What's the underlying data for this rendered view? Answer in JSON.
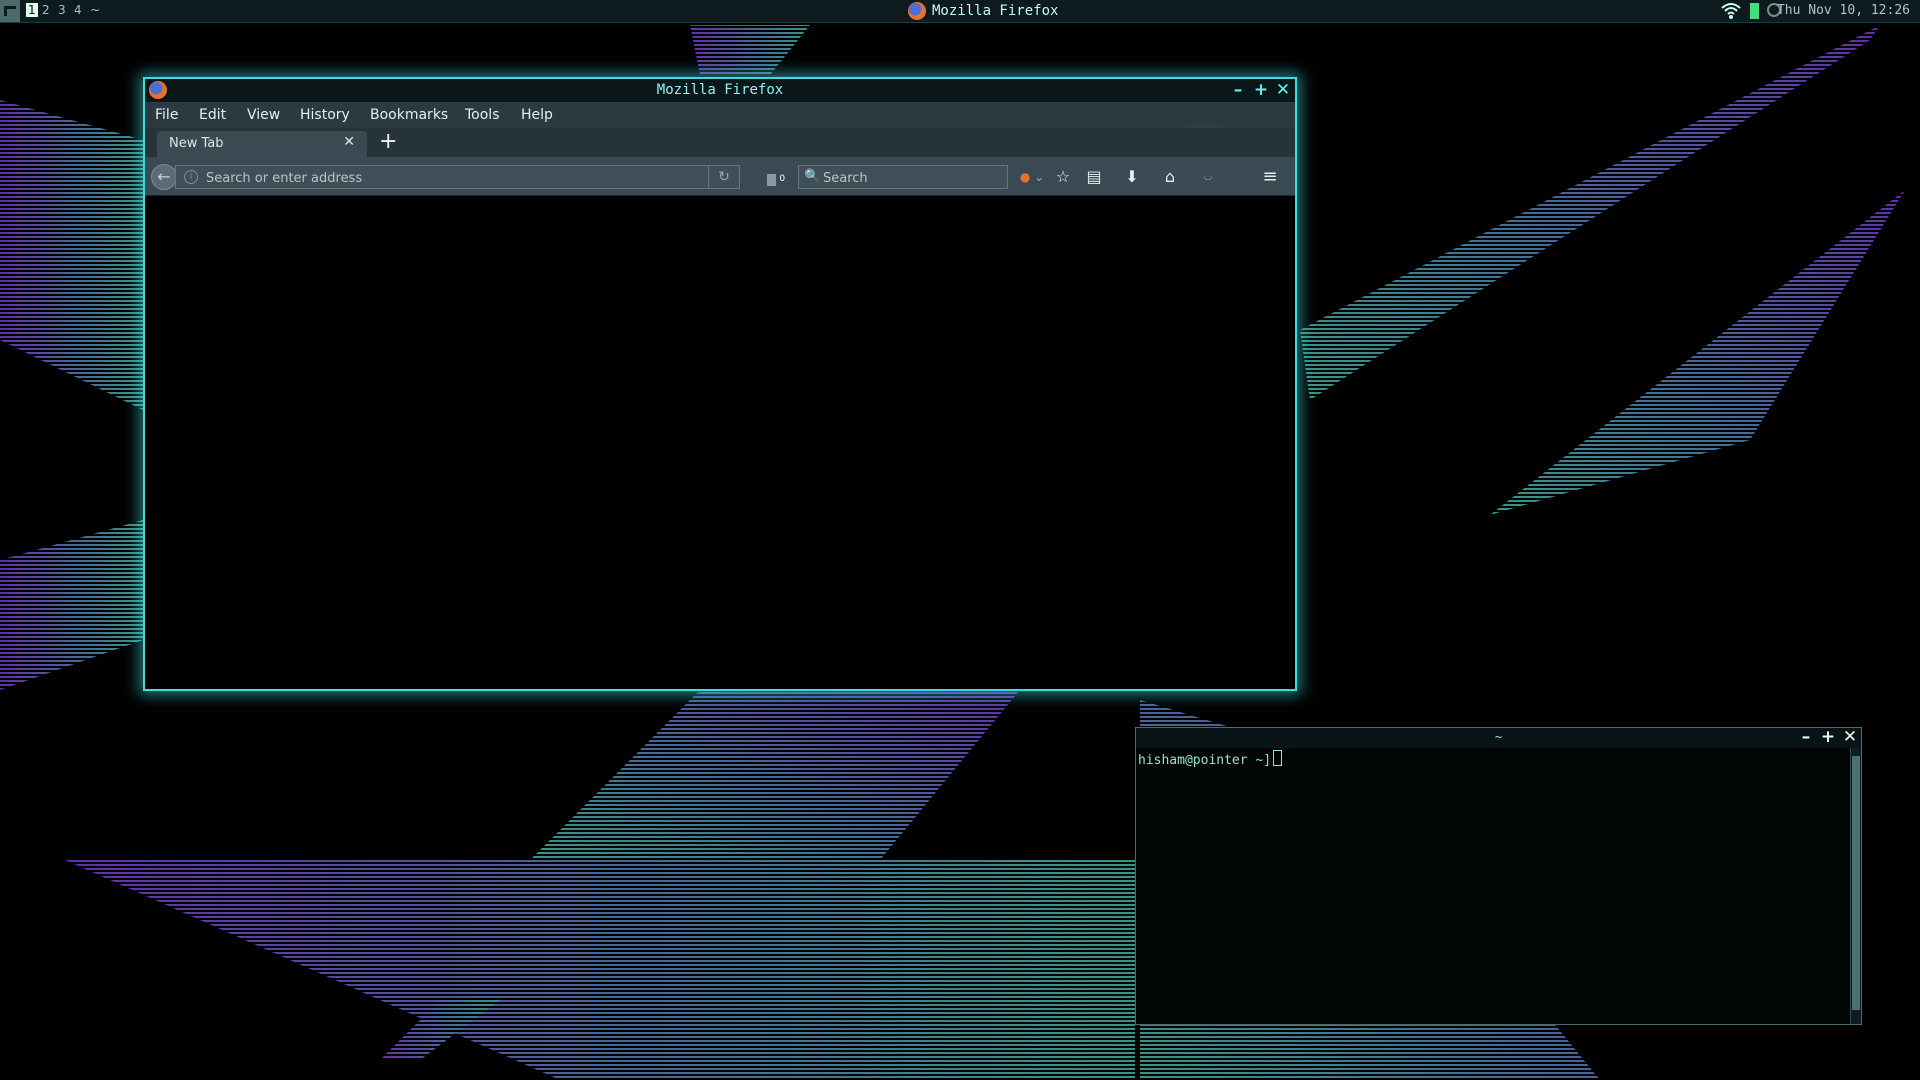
{
  "panel": {
    "workspaces": [
      "1",
      "2",
      "3",
      "4",
      "~"
    ],
    "active_workspace": "1",
    "taskbar_title": "Mozilla Firefox",
    "clock": "Thu Nov 10, 12:26",
    "tray_icons": [
      "wifi-icon",
      "battery-icon",
      "volume-icon"
    ]
  },
  "firefox": {
    "title": "Mozilla Firefox",
    "menu": [
      "File",
      "Edit",
      "View",
      "History",
      "Bookmarks",
      "Tools",
      "Help"
    ],
    "tab_label": "New Tab",
    "url_placeholder": "Search or enter address",
    "search_placeholder": "Search",
    "download_badge": "0",
    "toolbar_icons": [
      "pocket-icon",
      "star-icon",
      "reading-list-icon",
      "download-icon",
      "home-icon",
      "extension-icon",
      "hamburger-menu-icon"
    ]
  },
  "terminal": {
    "title": "~",
    "prompt": "hisham@pointer ~]"
  },
  "colors": {
    "accent": "#3ddbe0",
    "panel_bg": "#0d1a1e",
    "wallpaper_purple": "#7a3ad8",
    "wallpaper_teal": "#3fbfa8"
  }
}
